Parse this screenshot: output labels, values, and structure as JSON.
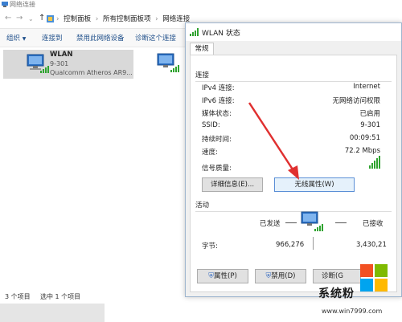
{
  "explorer": {
    "title": "网络连接",
    "breadcrumb": [
      "控制面板",
      "所有控制面板项",
      "网络连接"
    ],
    "commands": [
      "组织",
      "连接到",
      "禁用此网络设备",
      "诊断这个连接"
    ],
    "item": {
      "name": "WLAN",
      "ssid": "9-301",
      "adapter": "Qualcomm Atheros AR9..."
    },
    "status": {
      "count": "3 个项目",
      "selected": "选中 1 个项目"
    }
  },
  "dialog": {
    "title": "WLAN 状态",
    "tab": "常规",
    "connection_header": "连接",
    "rows": [
      {
        "label": "IPv4 连接:",
        "value": "Internet"
      },
      {
        "label": "IPv6 连接:",
        "value": "无网络访问权限"
      },
      {
        "label": "媒体状态:",
        "value": "已启用"
      },
      {
        "label": "SSID:",
        "value": "9-301"
      },
      {
        "label": "持续时间:",
        "value": "00:09:51"
      },
      {
        "label": "速度:",
        "value": "72.2 Mbps"
      }
    ],
    "signal_label": "信号质量:",
    "details_button": "详细信息(E)...",
    "wireless_button": "无线属性(W)",
    "activity_header": "活动",
    "sent_label": "已发送",
    "received_label": "已接收",
    "bytes_label": "字节:",
    "bytes_sent": "966,276",
    "bytes_received": "3,430,21",
    "properties_button": "属性(P)",
    "disable_button": "禁用(D)",
    "diagnose_button": "诊断(G"
  },
  "watermark": {
    "site": "系统粉",
    "url": "www.win7999.com"
  },
  "colors": {
    "signal": "#2fa32f",
    "link": "#1f4f8a",
    "arrow": "#e03030",
    "accent": "#5b8fd6"
  }
}
